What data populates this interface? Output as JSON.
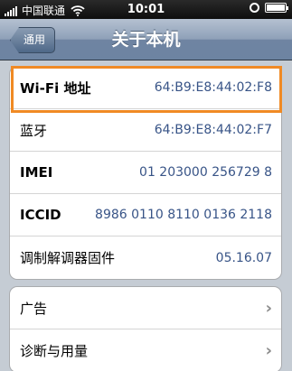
{
  "status_bar": {
    "carrier": "中国联通",
    "time": "10:01"
  },
  "nav": {
    "back_label": "通用",
    "title": "关于本机"
  },
  "about_rows": [
    {
      "label": "Wi-Fi 地址",
      "value": "64:B9:E8:44:02:F8"
    },
    {
      "label": "蓝牙",
      "value": "64:B9:E8:44:02:F7"
    },
    {
      "label": "IMEI",
      "value": "01 203000 256729 8"
    },
    {
      "label": "ICCID",
      "value": "8986 0110 8110 0136 2118"
    },
    {
      "label": "调制解调器固件",
      "value": "05.16.07"
    }
  ],
  "menu_rows": [
    {
      "label": "广告"
    },
    {
      "label": "诊断与用量"
    }
  ],
  "colors": {
    "highlight": "#f08a24",
    "value_text": "#385487"
  },
  "icons": {
    "signal": "signal-bars-icon",
    "wifi": "wifi-icon",
    "lock": "rotation-lock-icon",
    "battery": "battery-icon",
    "chevron": "chevron-right-icon"
  }
}
